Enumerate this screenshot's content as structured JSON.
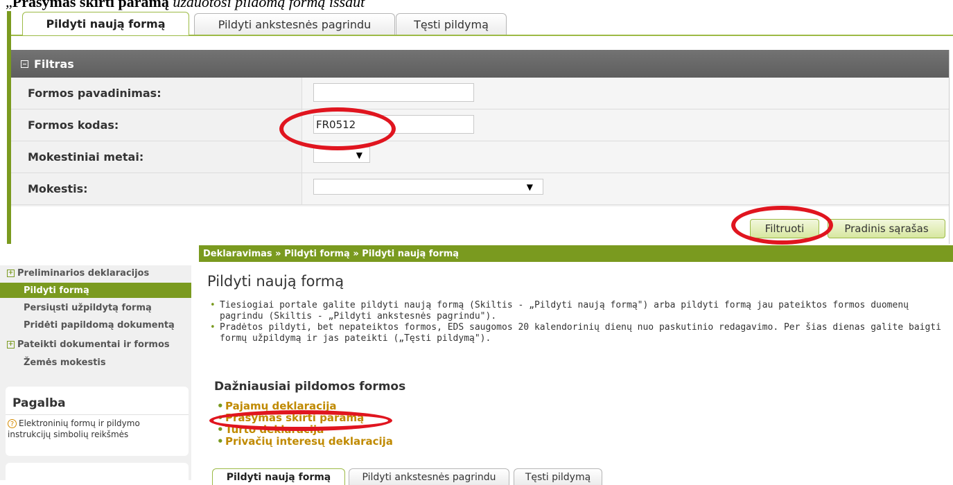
{
  "caption": {
    "quote": "„",
    "bold_part": "Prašymas skirti paramą",
    "italic_part": " užduotosi pildomą formą išsaut"
  },
  "top_tabs": [
    "Pildyti naują formą",
    "Pildyti ankstesnės pagrindu",
    "Tęsti pildymą"
  ],
  "filter": {
    "title": "Filtras",
    "rows": [
      {
        "label": "Formos pavadinimas:",
        "value": ""
      },
      {
        "label": "Formos kodas:",
        "value": "FR0512"
      },
      {
        "label": "Mokestiniai metai:",
        "value": ""
      },
      {
        "label": "Mokestis:",
        "value": ""
      }
    ],
    "filter_button": "Filtruoti",
    "reset_button": "Pradinis sąrašas"
  },
  "sidebar": {
    "items": [
      {
        "label": "Preliminarios deklaracijos",
        "expandable": true
      },
      {
        "label": "Pildyti formą",
        "active": true
      },
      {
        "label": "Persiųsti užpildytą formą"
      },
      {
        "label": "Pridėti papildomą dokumentą"
      },
      {
        "label": "Pateikti dokumentai ir formos",
        "expandable": true
      },
      {
        "label": "Žemės mokestis"
      }
    ],
    "help_title": "Pagalba",
    "help_link": "Elektroninių formų ir pildymo instrukcijų simbolių reikšmės"
  },
  "breadcrumb": "Deklaravimas » Pildyti formą » Pildyti naują formą",
  "main": {
    "page_title": "Pildyti naują formą",
    "intro": [
      "Tiesiogiai portale galite pildyti naują formą (Skiltis - „Pildyti naują formą\") arba pildyti formą jau pateiktos formos duomenų pagrindu (Skiltis - „Pildyti ankstesnės pagrindu\").",
      "Pradėtos pildyti, bet nepateiktos formos, EDS saugomos 20 kalendorinių dienų nuo paskutinio redagavimo. Per šias dienas galite baigti formų užpildymą ir jas pateikti („Tęsti pildymą\")."
    ],
    "frequent_title": "Dažniausiai pildomos formos",
    "frequent_forms": [
      "Pajamų deklaracija",
      "Prašymas skirti paramą",
      "Turto deklaracija",
      "Privačių interesų deklaracija"
    ],
    "bottom_tabs": [
      "Pildyti naują formą",
      "Pildyti ankstesnės pagrindu",
      "Tęsti pildymą"
    ]
  },
  "colors": {
    "accent_green": "#7a9a1f",
    "annotation_red": "#e0151f",
    "link_orange": "#c08a00"
  },
  "icons": [
    "minus-icon",
    "dropdown-arrow-icon",
    "plus-icon",
    "help-icon"
  ]
}
